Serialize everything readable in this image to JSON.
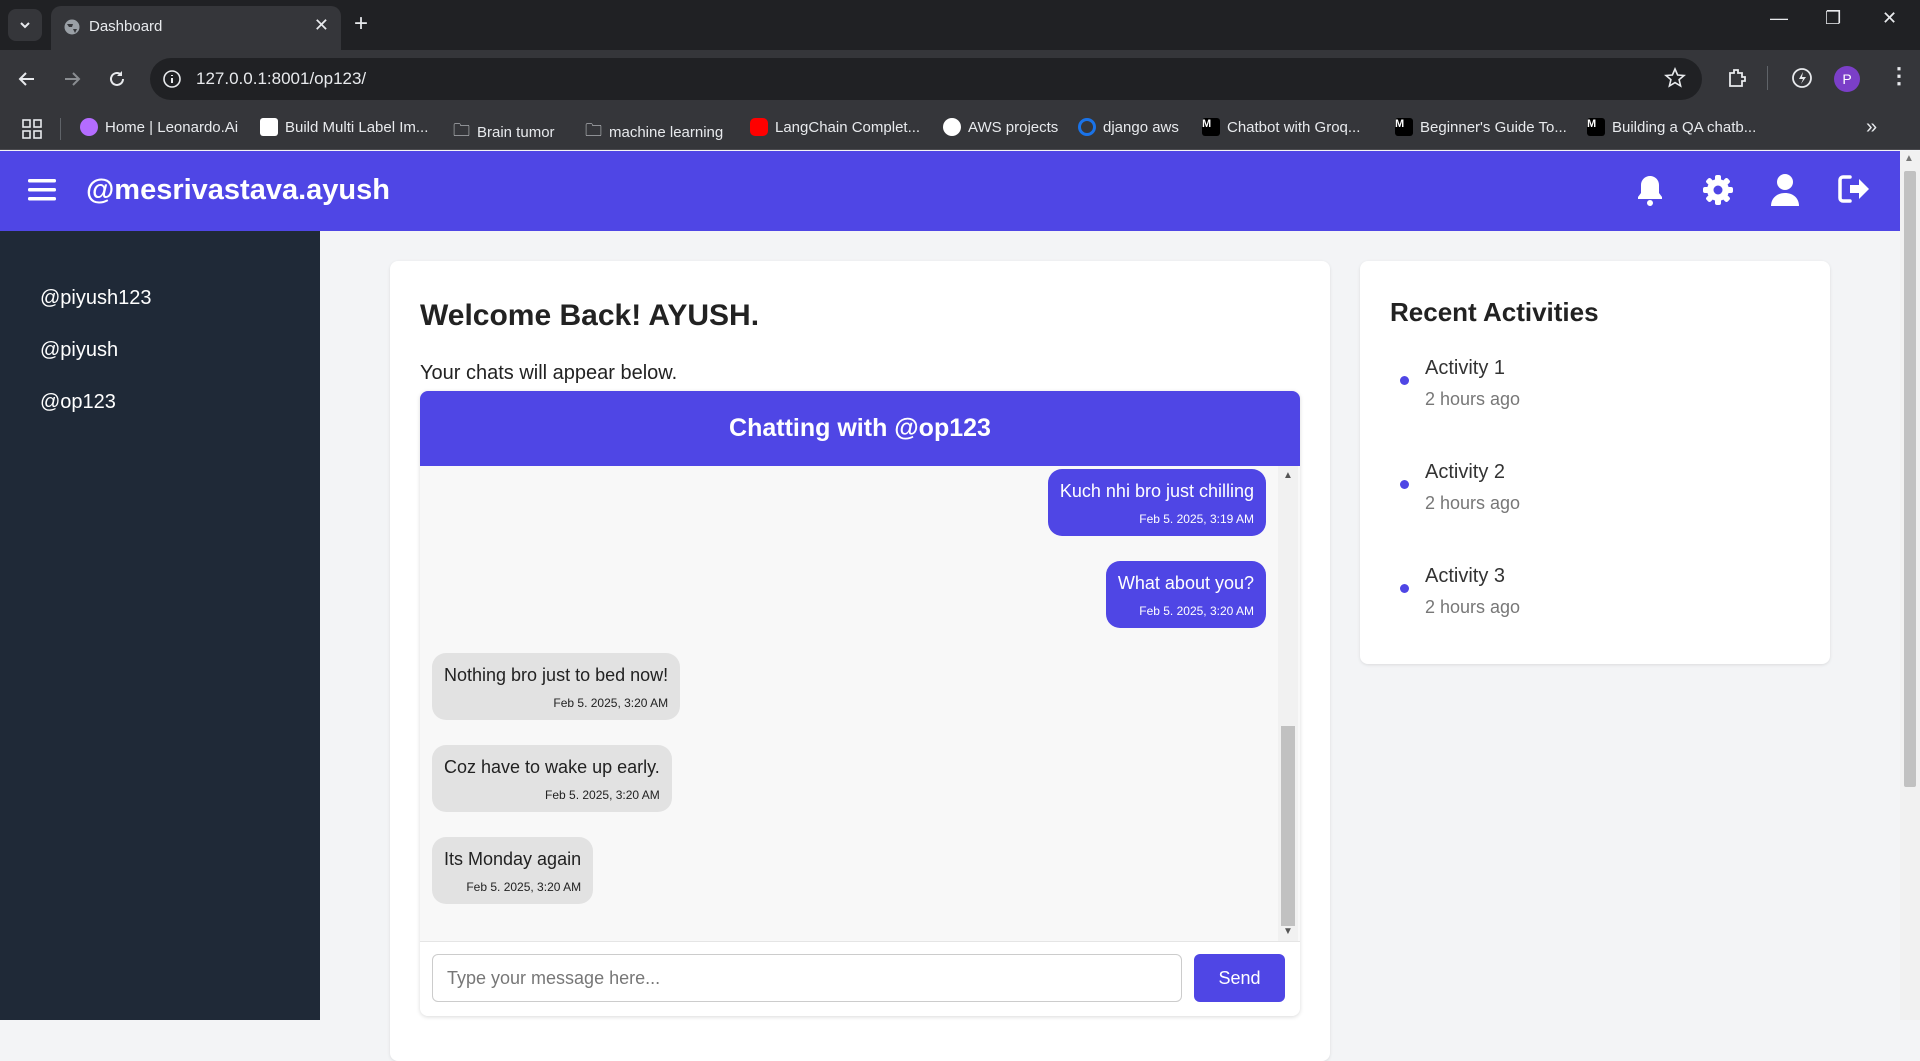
{
  "browser": {
    "tab_title": "Dashboard",
    "url": "127.0.0.1:8001/op123/",
    "profile_initial": "P",
    "bookmarks": [
      {
        "label": "Home | Leonardo.Ai",
        "color": "#b46cff"
      },
      {
        "label": "Build Multi Label Im...",
        "color": "#ffffff"
      },
      {
        "label": "Brain tumor",
        "color": "folder"
      },
      {
        "label": "machine learning",
        "color": "folder"
      },
      {
        "label": "LangChain Complet...",
        "color": "#ff0000"
      },
      {
        "label": "AWS projects",
        "color": "#ffffff"
      },
      {
        "label": "django aws",
        "color": "#1a73e8"
      },
      {
        "label": "Chatbot with Groq...",
        "color": "#000000"
      },
      {
        "label": "Beginner's Guide To...",
        "color": "#000000"
      },
      {
        "label": "Building a QA chatb...",
        "color": "#000000"
      }
    ]
  },
  "app": {
    "brand": "@mesrivastava.ayush",
    "accent": "#4f46e5",
    "sidebar": [
      "@piyush123",
      "@piyush",
      "@op123"
    ],
    "welcome": "Welcome Back! AYUSH.",
    "subtitle": "Your chats will appear below.",
    "chat": {
      "header": "Chatting with @op123",
      "messages": [
        {
          "text": "Kuch nhi bro just chilling",
          "time": "Feb 5. 2025, 3:19 AM",
          "dir": "sent"
        },
        {
          "text": "What about you?",
          "time": "Feb 5. 2025, 3:20 AM",
          "dir": "sent"
        },
        {
          "text": "Nothing bro just to bed now!",
          "time": "Feb 5. 2025, 3:20 AM",
          "dir": "received"
        },
        {
          "text": "Coz have to wake up early.",
          "time": "Feb 5. 2025, 3:20 AM",
          "dir": "received"
        },
        {
          "text": "Its Monday again",
          "time": "Feb 5. 2025, 3:20 AM",
          "dir": "received"
        }
      ],
      "input_placeholder": "Type your message here...",
      "send_label": "Send"
    },
    "activities": {
      "title": "Recent Activities",
      "items": [
        {
          "name": "Activity 1",
          "when": "2 hours ago"
        },
        {
          "name": "Activity 2",
          "when": "2 hours ago"
        },
        {
          "name": "Activity 3",
          "when": "2 hours ago"
        }
      ]
    }
  }
}
